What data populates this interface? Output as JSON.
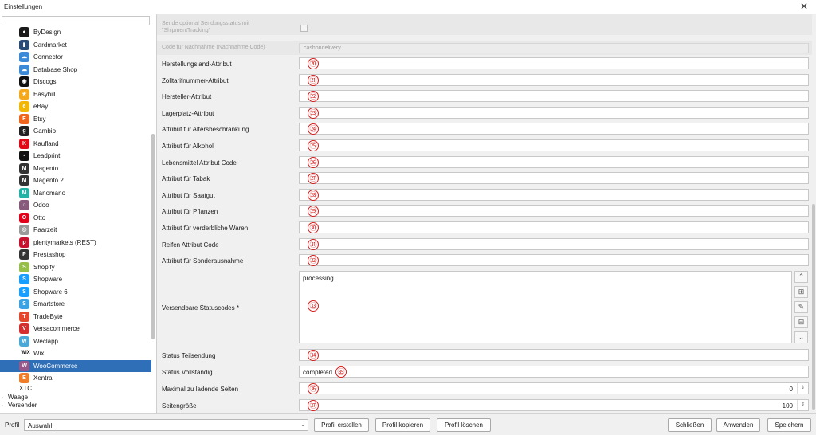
{
  "window": {
    "title": "Einstellungen",
    "close_glyph": "✕"
  },
  "sidebar": {
    "items": [
      {
        "label": "ByDesign",
        "icon": "bydesign-icon",
        "glyph": "●",
        "color": "#1a1a1a"
      },
      {
        "label": "Cardmarket",
        "icon": "cardmarket-icon",
        "glyph": "▮",
        "color": "#2a4b76"
      },
      {
        "label": "Connector",
        "icon": "cloud-icon",
        "glyph": "☁",
        "color": "#3b8ad8"
      },
      {
        "label": "Database Shop",
        "icon": "cloud-icon",
        "glyph": "☁",
        "color": "#3b8ad8"
      },
      {
        "label": "Discogs",
        "icon": "discogs-icon",
        "glyph": "◉",
        "color": "#111111"
      },
      {
        "label": "Easybill",
        "icon": "easybill-icon",
        "glyph": "★",
        "color": "#f4a81c"
      },
      {
        "label": "eBay",
        "icon": "ebay-icon",
        "glyph": "e",
        "color": "#f2b705"
      },
      {
        "label": "Etsy",
        "icon": "etsy-icon",
        "glyph": "E",
        "color": "#f1641e"
      },
      {
        "label": "Gambio",
        "icon": "gambio-icon",
        "glyph": "g",
        "color": "#222222"
      },
      {
        "label": "Kaufland",
        "icon": "kaufland-icon",
        "glyph": "K",
        "color": "#e10915"
      },
      {
        "label": "Leadprint",
        "icon": "leadprint-icon",
        "glyph": "▪",
        "color": "#111111"
      },
      {
        "label": "Magento",
        "icon": "magento-icon",
        "glyph": "M",
        "color": "#333333"
      },
      {
        "label": "Magento 2",
        "icon": "magento-icon",
        "glyph": "M",
        "color": "#333333"
      },
      {
        "label": "Manomano",
        "icon": "manomano-icon",
        "glyph": "M",
        "color": "#22b3a6"
      },
      {
        "label": "Odoo",
        "icon": "odoo-icon",
        "glyph": "○",
        "color": "#875a7b"
      },
      {
        "label": "Otto",
        "icon": "otto-icon",
        "glyph": "O",
        "color": "#e3001b"
      },
      {
        "label": "Paarzeit",
        "icon": "paarzeit-icon",
        "glyph": "◎",
        "color": "#9a9a9a"
      },
      {
        "label": "plentymarkets (REST)",
        "icon": "plentymarkets-icon",
        "glyph": "p",
        "color": "#c6102e"
      },
      {
        "label": "Prestashop",
        "icon": "prestashop-icon",
        "glyph": "P",
        "color": "#333333"
      },
      {
        "label": "Shopify",
        "icon": "shopify-icon",
        "glyph": "S",
        "color": "#95bf47"
      },
      {
        "label": "Shopware",
        "icon": "shopware-icon",
        "glyph": "S",
        "color": "#189eff"
      },
      {
        "label": "Shopware 6",
        "icon": "shopware-icon",
        "glyph": "S",
        "color": "#189eff"
      },
      {
        "label": "Smartstore",
        "icon": "smartstore-icon",
        "glyph": "S",
        "color": "#3aa3e3"
      },
      {
        "label": "TradeByte",
        "icon": "tradebyte-icon",
        "glyph": "T",
        "color": "#e4472c"
      },
      {
        "label": "Versacommerce",
        "icon": "versacommerce-icon",
        "glyph": "V",
        "color": "#d42e2e"
      },
      {
        "label": "Weclapp",
        "icon": "weclapp-icon",
        "glyph": "w",
        "color": "#4aa8d8"
      },
      {
        "label": "Wix",
        "icon": "wix-icon",
        "glyph": "WIX",
        "color": "#ffffff"
      },
      {
        "label": "WooCommerce",
        "icon": "woocommerce-icon",
        "glyph": "W",
        "color": "#96588a",
        "selected": true
      },
      {
        "label": "Xentral",
        "icon": "xentral-icon",
        "glyph": "E",
        "color": "#f07d2a"
      }
    ],
    "trailing": "XTC",
    "groups": [
      "Waage",
      "Versender"
    ],
    "selection_color": "#2f6fb7"
  },
  "form": {
    "optional_status_label": "Sende optional Sendungsstatus mit \"ShipmentTracking\"",
    "cod_label": "Code für Nachnahme (Nachnahme Code)",
    "cod_value": "cashondelivery",
    "fields": [
      {
        "label": "Herstellungsland-Attribut",
        "marker": "⑳"
      },
      {
        "label": "Zolltarifnummer-Attribut",
        "marker": "㉑"
      },
      {
        "label": "Hersteller-Attribut",
        "marker": "㉒"
      },
      {
        "label": "Lagerplatz-Attribut",
        "marker": "㉓"
      },
      {
        "label": "Attribut für Altersbeschränkung",
        "marker": "㉔"
      },
      {
        "label": "Attribut für Alkohol",
        "marker": "㉕"
      },
      {
        "label": "Lebensmittel Attribut Code",
        "marker": "㉖"
      },
      {
        "label": "Attribut für Tabak",
        "marker": "㉗"
      },
      {
        "label": "Attribut für Saatgut",
        "marker": "㉘"
      },
      {
        "label": "Attribut für Pflanzen",
        "marker": "㉙"
      },
      {
        "label": "Attribut für verderbliche Waren",
        "marker": "㉚"
      },
      {
        "label": "Reifen Attribut Code",
        "marker": "㉛"
      },
      {
        "label": "Attribut für Sonderausnahme",
        "marker": "㉜"
      }
    ],
    "shippable": {
      "label": "Versendbare Statuscodes *",
      "value": "processing",
      "marker": "㉝"
    },
    "partial": {
      "label": "Status Teilsendung",
      "marker": "㉞"
    },
    "complete": {
      "label": "Status Vollständig",
      "value": "completed",
      "marker": "㉟"
    },
    "max_pages": {
      "label": "Maximal zu ladende Seiten",
      "value": "0",
      "marker": "㊱"
    },
    "page_size": {
      "label": "Seitengröße",
      "value": "100",
      "marker": "㊲"
    },
    "list_tools": {
      "up": "⌃",
      "add": "⊞",
      "edit": "✎",
      "remove": "⊟",
      "down": "⌄"
    },
    "spin_glyph": "⇕",
    "marker_color": "#d42020"
  },
  "bottombar": {
    "profile_label": "Profil",
    "profile_value": "Auswahl",
    "create": "Profil erstellen",
    "copy": "Profil kopieren",
    "delete": "Profil löschen",
    "close": "Schließen",
    "apply": "Anwenden",
    "save": "Speichern",
    "dropdown_glyph": "⌄"
  }
}
